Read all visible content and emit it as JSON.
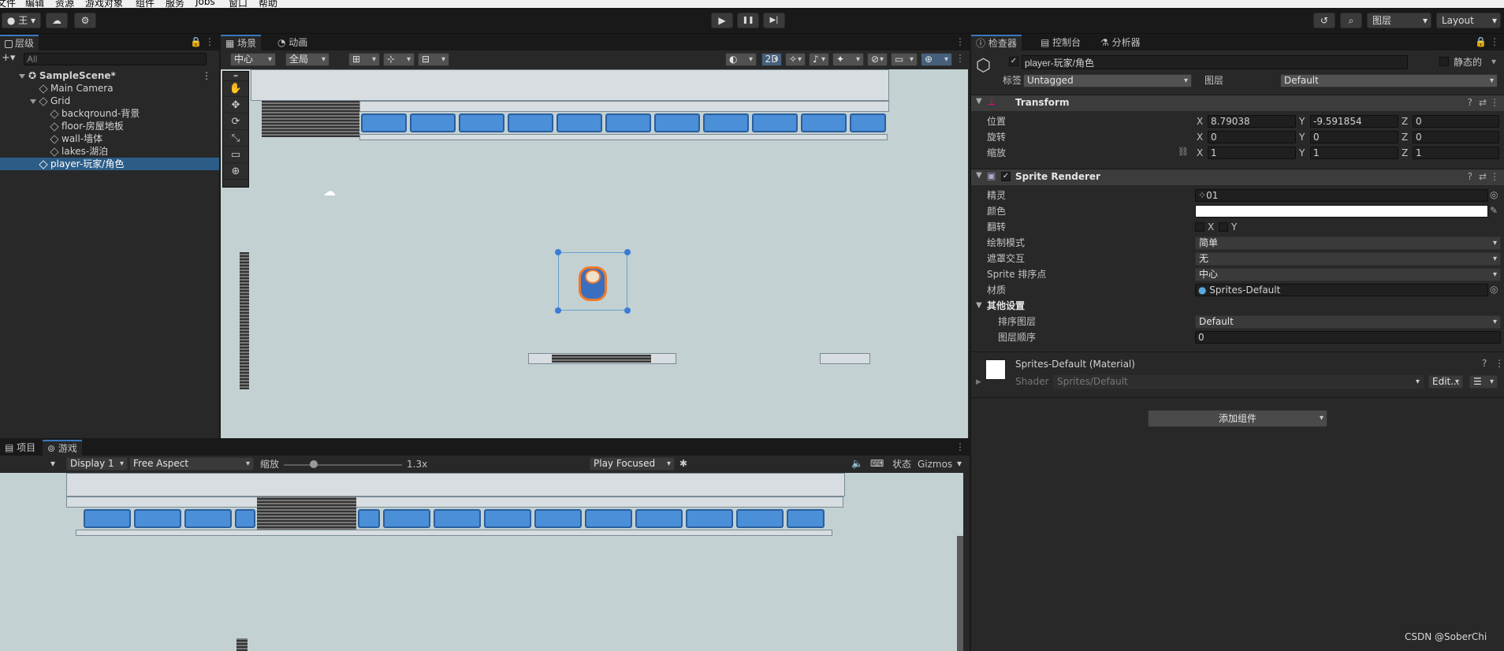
{
  "menubar": {
    "items": [
      "文件",
      "编辑",
      "资源",
      "游戏对象",
      "组件",
      "服务",
      "Jobs",
      "窗口",
      "帮助"
    ]
  },
  "toolbar": {
    "account": "王",
    "play": "▶",
    "pause": "❚❚",
    "step": "▶|",
    "layers": "图层",
    "layout": "Layout"
  },
  "hierarchy": {
    "tab": "层级",
    "search_placeholder": "All",
    "items": [
      {
        "label": "SampleScene*",
        "level": 0
      },
      {
        "label": "Main Camera",
        "level": 1
      },
      {
        "label": "Grid",
        "level": 1
      },
      {
        "label": "backqround-背景",
        "level": 2
      },
      {
        "label": "floor-房屋地板",
        "level": 2
      },
      {
        "label": "wall-墙体",
        "level": 2
      },
      {
        "label": "lakes-湖泊",
        "level": 2
      },
      {
        "label": "player-玩家/角色",
        "level": 1,
        "selected": true
      }
    ]
  },
  "scene": {
    "tabs": [
      "场景",
      "动画"
    ],
    "pivot": "中心",
    "global": "全局",
    "mode2d": "2D"
  },
  "bottom": {
    "tabs": [
      "项目",
      "游戏"
    ],
    "display": "Display 1",
    "aspect": "Free Aspect",
    "scale_label": "缩放",
    "scale_value": "1.3x",
    "scale_fraction": 0.25,
    "play_focused": "Play Focused",
    "stats": "状态",
    "gizmos": "Gizmos"
  },
  "inspector": {
    "tabs": [
      "检查器",
      "控制台",
      "分析器"
    ],
    "object_name": "player-玩家/角色",
    "static_label": "静态的",
    "tag_label": "标签",
    "tag_value": "Untagged",
    "layer_label": "图层",
    "layer_value": "Default",
    "transform": {
      "title": "Transform",
      "position_label": "位置",
      "rotation_label": "旋转",
      "scale_label": "缩放",
      "position": {
        "x": "8.79038",
        "y": "-9.591854",
        "z": "0"
      },
      "rotation": {
        "x": "0",
        "y": "0",
        "z": "0"
      },
      "scale": {
        "x": "1",
        "y": "1",
        "z": "1"
      }
    },
    "sprite_renderer": {
      "title": "Sprite Renderer",
      "sprite_label": "精灵",
      "sprite_value": "01",
      "color_label": "颜色",
      "color_value": "#ffffff",
      "flip_label": "翻转",
      "flip_x": "X",
      "flip_y": "Y",
      "draw_mode_label": "绘制模式",
      "draw_mode_value": "简单",
      "mask_label": "遮罩交互",
      "mask_value": "无",
      "sort_point_label": "Sprite 排序点",
      "sort_point_value": "中心",
      "material_label": "材质",
      "material_value": "Sprites-Default",
      "additional_label": "其他设置",
      "sorting_layer_label": "排序图层",
      "sorting_layer_value": "Default",
      "order_label": "图层顺序",
      "order_value": "0"
    },
    "material": {
      "title": "Sprites-Default (Material)",
      "shader_label": "Shader",
      "shader_value": "Sprites/Default",
      "edit_label": "Edit..."
    },
    "add_component": "添加组件"
  },
  "watermark": "CSDN @SoberChi"
}
